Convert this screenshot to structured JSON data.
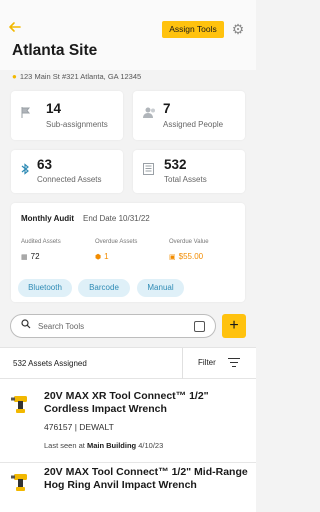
{
  "header": {
    "back_icon": "arrow-left-icon",
    "assign_label": "Assign Tools",
    "settings_icon": "gear-icon",
    "site_name": "Atlanta Site",
    "address": "123 Main St #321 Atlanta, GA 12345"
  },
  "stats": [
    {
      "icon": "flag-icon",
      "value": "14",
      "label": "Sub-assignments"
    },
    {
      "icon": "people-icon",
      "value": "7",
      "label": "Assigned People"
    },
    {
      "icon": "bluetooth-icon",
      "value": "63",
      "label": "Connected Assets"
    },
    {
      "icon": "building-icon",
      "value": "532",
      "label": "Total Assets"
    }
  ],
  "audit": {
    "title": "Monthly Audit",
    "end_date": "End Date 10/31/22",
    "columns": [
      {
        "header": "Audited Assets",
        "value": "72",
        "color": "#333333"
      },
      {
        "header": "Overdue Assets",
        "value": "1",
        "color": "#f28c00"
      },
      {
        "header": "Overdue Value",
        "value": "$55.00",
        "color": "#f28c00"
      }
    ],
    "tags": [
      "Bluetooth",
      "Barcode",
      "Manual"
    ]
  },
  "search": {
    "placeholder": "Search Tools",
    "add_label": "+"
  },
  "list_bar": {
    "count": "532 Assets Assigned",
    "filter_label": "Filter"
  },
  "assets": [
    {
      "name": "20V MAX XR Tool Connect™ 1/2\" Cordless Impact Wrench",
      "sku": "476157 | DEWALT",
      "seen_prefix": "Last seen at",
      "seen_location": "Main Building",
      "seen_date": "4/10/23"
    },
    {
      "name": "20V MAX Tool Connect™ 1/2\" Mid-Range Hog Ring Anvil Impact Wrench",
      "sku": "",
      "seen_prefix": "",
      "seen_location": "",
      "seen_date": ""
    }
  ],
  "colors": {
    "brand_yellow": "#ffc20e",
    "tag_bg": "#dff0f8",
    "tag_text": "#2f8bb5",
    "warning": "#f28c00"
  }
}
